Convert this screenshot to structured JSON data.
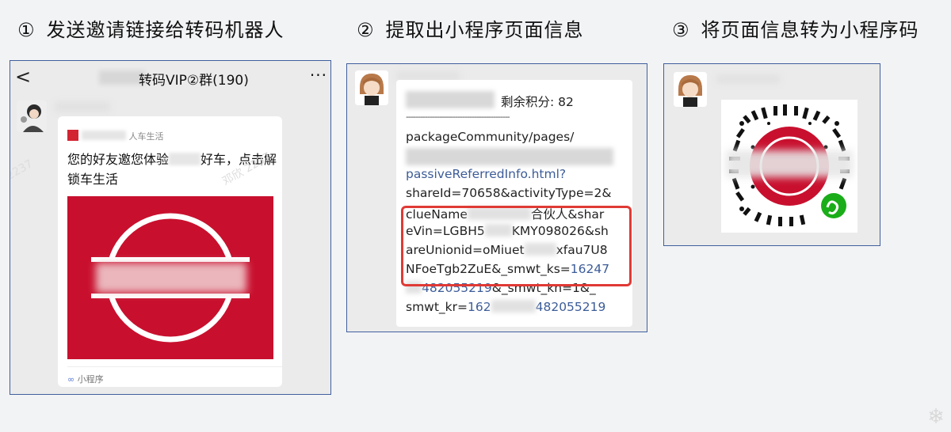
{
  "steps": [
    {
      "num": "①",
      "text": "发送邀请链接给转码机器人"
    },
    {
      "num": "②",
      "text": "提取出小程序页面信息"
    },
    {
      "num": "③",
      "text": "将页面信息转为小程序码"
    }
  ],
  "panel1": {
    "back": "<",
    "title": "转码VIP②群(190)",
    "more": "···",
    "card_brand": "人车生活",
    "card_desc_a": "您的好友邀您体验",
    "card_desc_b": "好车，点击解锁车生活",
    "mini_program": "小程序",
    "watermark_a": "2237",
    "watermark_b": "邓欣 2237"
  },
  "panel2": {
    "points_label": "剩余积分: 82",
    "dashes": "--------------------------------------------",
    "l1": "packageCommunity/pages/",
    "l2": "passiveReferredInfo.html?",
    "l3": "shareId=70658&activityType=2&",
    "l4a": "clueName",
    "l4b": "合伙人&shar",
    "l5a": "eVin=LGBH5",
    "l5b": "KMY098026&sh",
    "l6a": "areUnionid=oMiuet",
    "l6b": "xfau7U8",
    "l7a": "NFoeTgb2ZuE&_smwt_ks=",
    "l7b": "16247",
    "l8a": "482055219",
    "l8b": "&_smwt_kn=1&_",
    "l9a": "smwt_kr=",
    "l9b": "162",
    "l9c": "482055219"
  },
  "colors": {
    "accent_red": "#e03a35",
    "link_blue": "#3c5c98",
    "brand_red": "#c8102e",
    "wechat_green": "#1aad19"
  }
}
